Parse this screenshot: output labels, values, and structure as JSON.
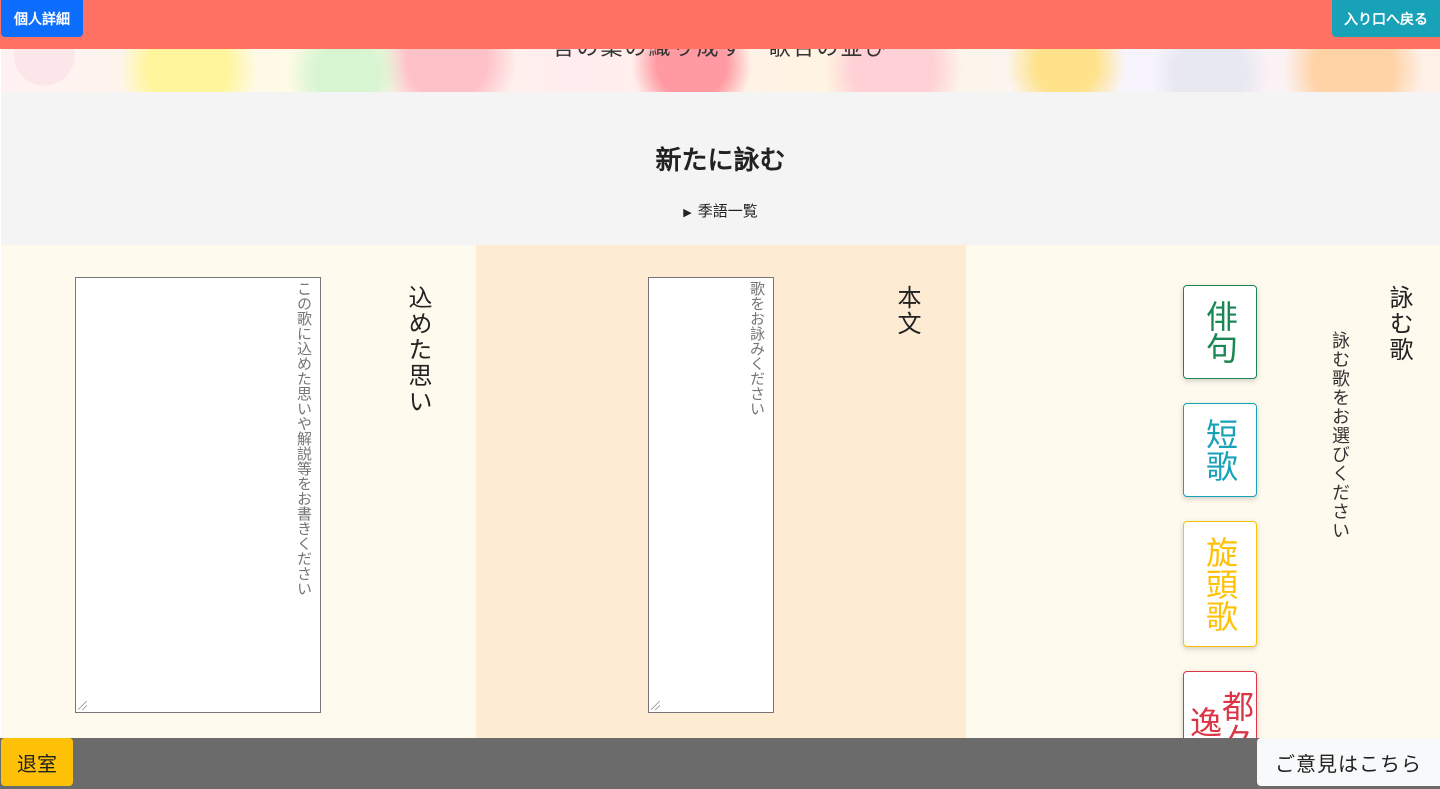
{
  "topbar": {
    "profile_button": "個人詳細",
    "back_button": "入り口へ戻る"
  },
  "banner": {
    "title": "言の葉の織り成す　歌合の並び"
  },
  "header": {
    "title": "新たに詠む",
    "season_words_toggle": "季語一覧"
  },
  "columns": {
    "thoughts": {
      "label": "込めた思い",
      "placeholder": "この歌に込めた思いや解説等をお書きください",
      "value": ""
    },
    "body": {
      "label": "本文",
      "placeholder": "歌をお詠みください",
      "value": ""
    },
    "type_select": {
      "label": "詠む歌",
      "instruction": "詠む歌をお選びください",
      "options": [
        "俳句",
        "短歌",
        "旋頭歌",
        "都々逸"
      ]
    }
  },
  "footer": {
    "exit_button": "退室",
    "feedback_button": "ご意見はこちら"
  },
  "colors": {
    "topbar": "#ff7163",
    "haiku": "#198754",
    "tanka": "#17a2b8",
    "sedoka": "#ffc107",
    "dodoitsu": "#dc3545",
    "footer": "#6b6b6b"
  }
}
